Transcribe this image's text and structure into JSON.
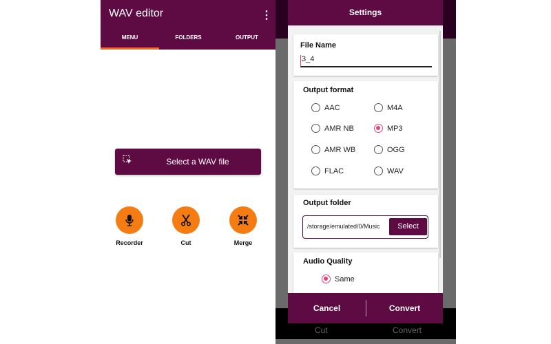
{
  "left": {
    "title": "WAV editor",
    "menu_icon": "more-vert-icon",
    "tabs": [
      {
        "label": "MENU",
        "active": true
      },
      {
        "label": "FOLDERS"
      },
      {
        "label": "OUTPUT"
      }
    ],
    "select_button": {
      "label": "Select a WAV file",
      "icon": "select-cursor-icon"
    },
    "actions": [
      {
        "label": "Recorder",
        "icon": "microphone-icon"
      },
      {
        "label": "Cut",
        "icon": "scissors-icon"
      },
      {
        "label": "Merge",
        "icon": "merge-arrows-icon"
      }
    ],
    "colors": {
      "primary": "#5e0a43",
      "accent": "#f57c12",
      "tab_indicator": "#f26a21"
    }
  },
  "background_bar": {
    "left": "Cut",
    "right": "Convert"
  },
  "dialog": {
    "title": "Settings",
    "file_name": {
      "label": "File Name",
      "value": "3_4"
    },
    "output_format": {
      "label": "Output format",
      "options": [
        {
          "label": "AAC",
          "selected": false
        },
        {
          "label": "M4A",
          "selected": false
        },
        {
          "label": "AMR NB",
          "selected": false
        },
        {
          "label": "MP3",
          "selected": true
        },
        {
          "label": "AMR WB",
          "selected": false
        },
        {
          "label": "OGG",
          "selected": false
        },
        {
          "label": "FLAC",
          "selected": false
        },
        {
          "label": "WAV",
          "selected": false
        }
      ]
    },
    "output_folder": {
      "label": "Output folder",
      "path": "/storage/emulated/0/Music",
      "select_label": "Select"
    },
    "audio_quality": {
      "label": "Audio Quality",
      "selected": "Same"
    },
    "cancel_label": "Cancel",
    "convert_label": "Convert",
    "radio_color": "#e0457b"
  }
}
